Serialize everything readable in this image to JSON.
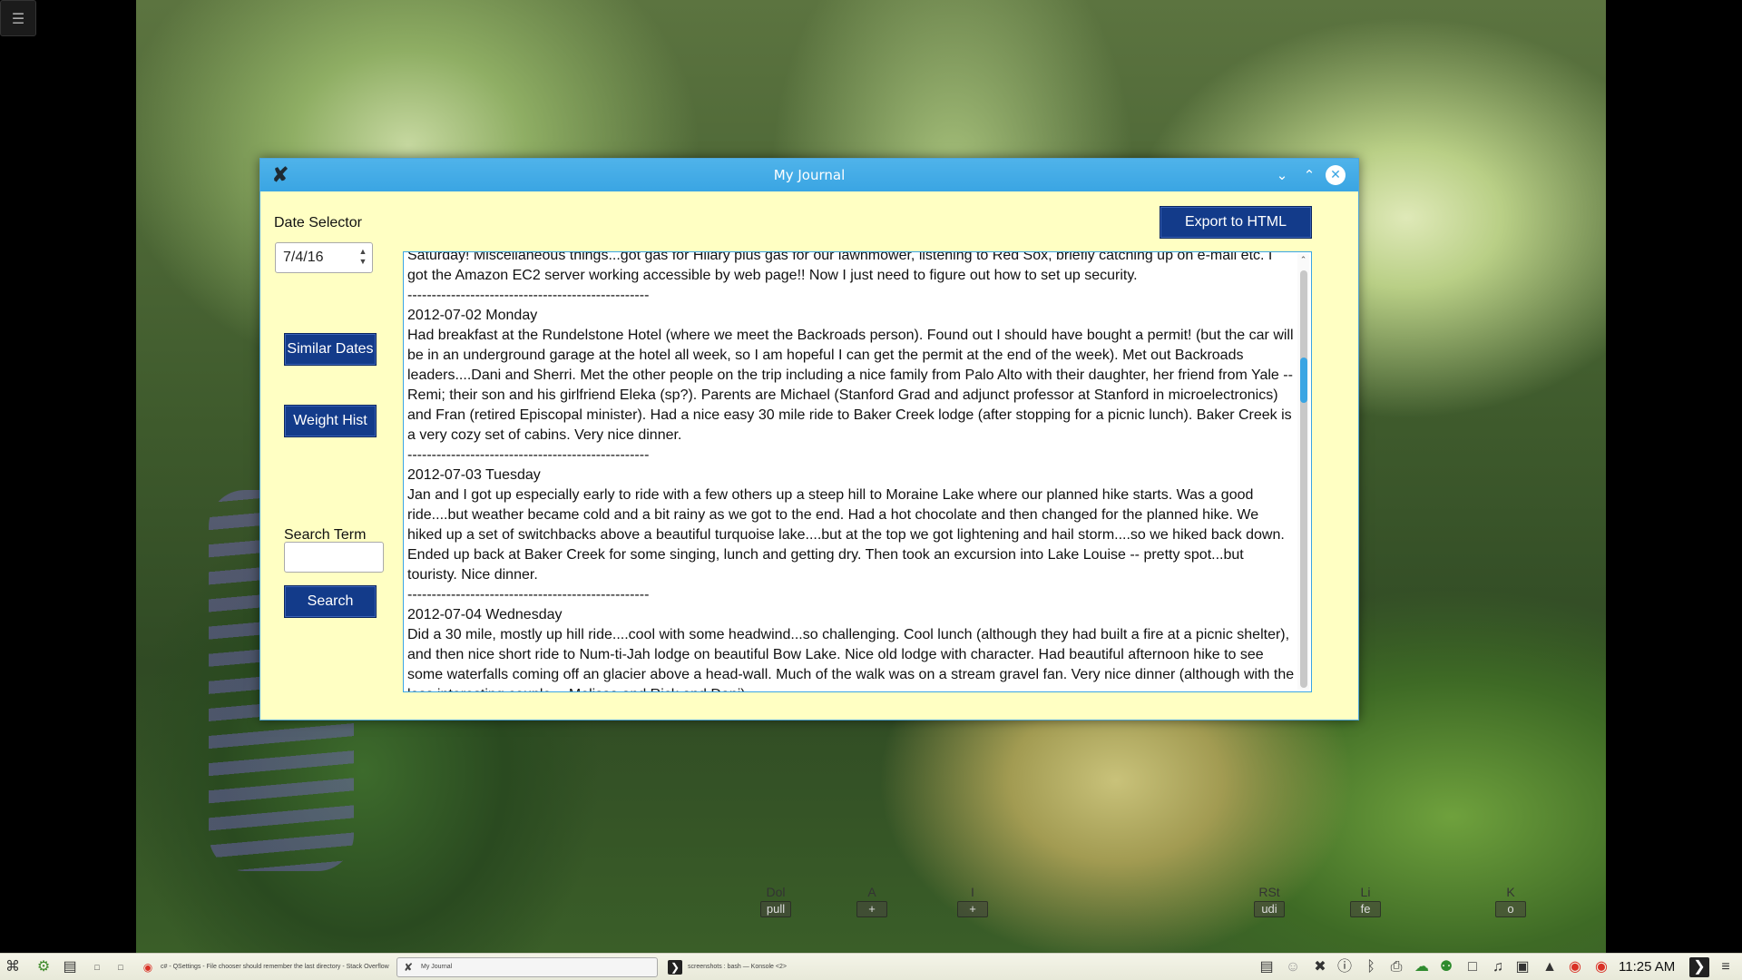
{
  "window": {
    "title": "My Journal",
    "minimize_icon": "chevron-down",
    "maximize_icon": "chevron-up",
    "close_icon": "close"
  },
  "left_panel": {
    "date_label": "Date Selector",
    "date_value": "7/4/16",
    "similar_dates_label": "Similar Dates",
    "weight_hist_label": "Weight Hist",
    "search_term_label": "Search Term",
    "search_value": "",
    "search_button_label": "Search"
  },
  "export_button_label": "Export to HTML",
  "journal": {
    "entries": [
      "Saturday! Miscellaneous things...got gas for Hilary plus gas for our lawnmower, listening to Red Sox, briefly catching up on e-mail etc. I got the Amazon EC2 server working accessible by web page!! Now I just need to figure out how to set up security.",
      "--------------------------------------------------",
      "2012-07-02 Monday",
      "Had breakfast at the Rundelstone Hotel (where we meet the Backroads person). Found out I should have bought a permit! (but the car will be in an underground garage at the hotel all week, so I am hopeful I can get the permit at the end of the week). Met out Backroads leaders....Dani and Sherri. Met the other people on the trip including a nice family from Palo Alto with their daughter, her friend from Yale -- Remi; their son and his girlfriend Eleka (sp?). Parents are Michael (Stanford Grad and adjunct professor at Stanford in microelectronics) and Fran (retired Episcopal minister). Had a nice easy 30 mile ride to Baker Creek lodge (after stopping for a picnic lunch). Baker Creek is a very cozy set of cabins. Very nice dinner.",
      "--------------------------------------------------",
      "2012-07-03 Tuesday",
      "Jan and I got up especially early to ride with a few others up a steep hill to Moraine Lake where our planned hike starts. Was a good ride....but weather became cold and a bit rainy as we got to the end. Had a hot chocolate and then changed for the planned hike. We hiked up a set of switchbacks above a beautiful turquoise lake....but at the top we got lightening and hail storm....so we hiked back down. Ended up back at Baker Creek for some singing, lunch and getting dry. Then took an excursion into Lake Louise -- pretty spot...but touristy. Nice dinner.",
      "--------------------------------------------------",
      "2012-07-04 Wednesday",
      "Did a 30 mile, mostly up hill ride....cool with some headwind...so challenging. Cool lunch (although they had built a fire at a picnic shelter), and then nice short ride to Num-ti-Jah lodge on beautiful Bow Lake. Nice old lodge with character. Had beautiful afternoon hike to see some waterfalls coming off an glacier above a head-wall. Much of the walk was on a stream gravel fan. Very nice dinner (although with the less interesting couple -- Melissa and Rick and Dani)."
    ]
  },
  "desktop_widgets": [
    {
      "top": "Dol",
      "box": "pull"
    },
    {
      "top": "A",
      "box": "+"
    },
    {
      "top": "I",
      "box": "+"
    },
    {
      "top": "RSt",
      "box": "udi"
    },
    {
      "top": "Li",
      "box": "fe"
    },
    {
      "top": "K",
      "box": "o"
    }
  ],
  "taskbar": {
    "tasks": [
      {
        "label": "c# - QSettings - File chooser should remember the last directory - Stack Overflow",
        "icon": "chrome-icon"
      },
      {
        "label": "My Journal",
        "icon": "app-icon"
      },
      {
        "label": "screenshots : bash — Konsole <2>",
        "icon": "terminal-icon"
      }
    ],
    "clock": "11:25 AM"
  }
}
